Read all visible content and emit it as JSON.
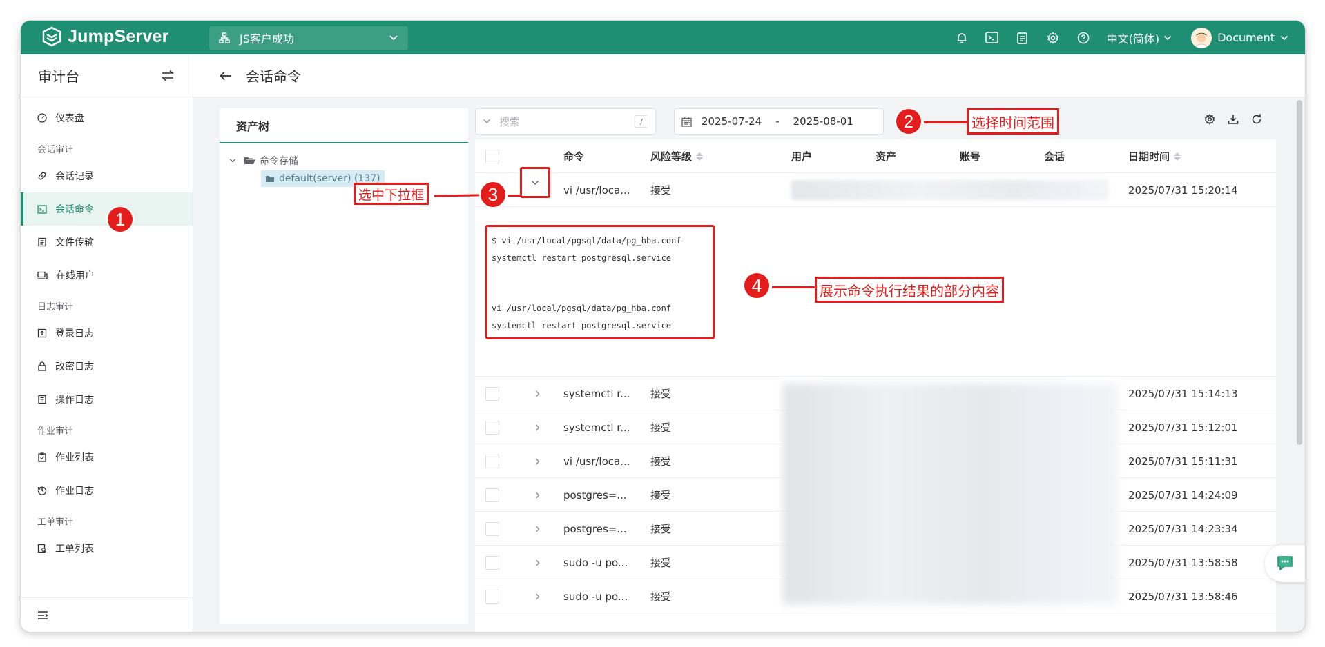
{
  "brand": {
    "name": "JumpServer"
  },
  "org": {
    "name": "JS客户成功"
  },
  "header": {
    "language": "中文(简体)",
    "user": "Document"
  },
  "sidebar": {
    "title": "审计台",
    "items": [
      {
        "label": "仪表盘"
      },
      {
        "group": "会话审计"
      },
      {
        "label": "会话记录"
      },
      {
        "label": "会话命令"
      },
      {
        "label": "文件传输"
      },
      {
        "label": "在线用户"
      },
      {
        "group": "日志审计"
      },
      {
        "label": "登录日志"
      },
      {
        "label": "改密日志"
      },
      {
        "label": "操作日志"
      },
      {
        "group": "作业审计"
      },
      {
        "label": "作业列表"
      },
      {
        "label": "作业日志"
      },
      {
        "group": "工单审计"
      },
      {
        "label": "工单列表"
      }
    ]
  },
  "page": {
    "title": "会话命令"
  },
  "tree": {
    "title": "资产树",
    "root": "命令存储",
    "leaf": "default(server) (137)"
  },
  "search": {
    "placeholder": "搜索",
    "shortcut": "/"
  },
  "date_range": {
    "start": "2025-07-24",
    "separator": "-",
    "end": "2025-08-01"
  },
  "table": {
    "columns": [
      "命令",
      "风险等级",
      "用户",
      "资产",
      "账号",
      "会话",
      "日期时间"
    ],
    "rows": [
      {
        "command": "vi /usr/loca...",
        "risk": "接受",
        "datetime": "2025/07/31 15:20:14",
        "expanded": true
      },
      {
        "command": "systemctl r...",
        "risk": "接受",
        "datetime": "2025/07/31 15:14:13"
      },
      {
        "command": "systemctl r...",
        "risk": "接受",
        "datetime": "2025/07/31 15:12:01"
      },
      {
        "command": "vi /usr/loca...",
        "risk": "接受",
        "datetime": "2025/07/31 15:11:31"
      },
      {
        "command": "postgres=...",
        "risk": "接受",
        "datetime": "2025/07/31 14:24:09"
      },
      {
        "command": "postgres=...",
        "risk": "接受",
        "datetime": "2025/07/31 14:23:34"
      },
      {
        "command": "sudo -u po...",
        "risk": "接受",
        "datetime": "2025/07/31 13:58:58"
      },
      {
        "command": "sudo -u po...",
        "risk": "接受",
        "datetime": "2025/07/31 13:58:46"
      }
    ],
    "expanded_output": [
      "$ vi /usr/local/pgsql/data/pg_hba.conf",
      "systemctl restart postgresql.service",
      "",
      "",
      "vi /usr/local/pgsql/data/pg_hba.conf",
      "systemctl restart postgresql.service"
    ]
  },
  "annotations": [
    {
      "number": "1"
    },
    {
      "number": "2",
      "text": "选择时间范围"
    },
    {
      "number": "3",
      "text": "选中下拉框"
    },
    {
      "number": "4",
      "text": "展示命令执行结果的部分内容"
    }
  ],
  "colors": {
    "brand": "#1f8f73",
    "annotation": "#e31c1c"
  }
}
